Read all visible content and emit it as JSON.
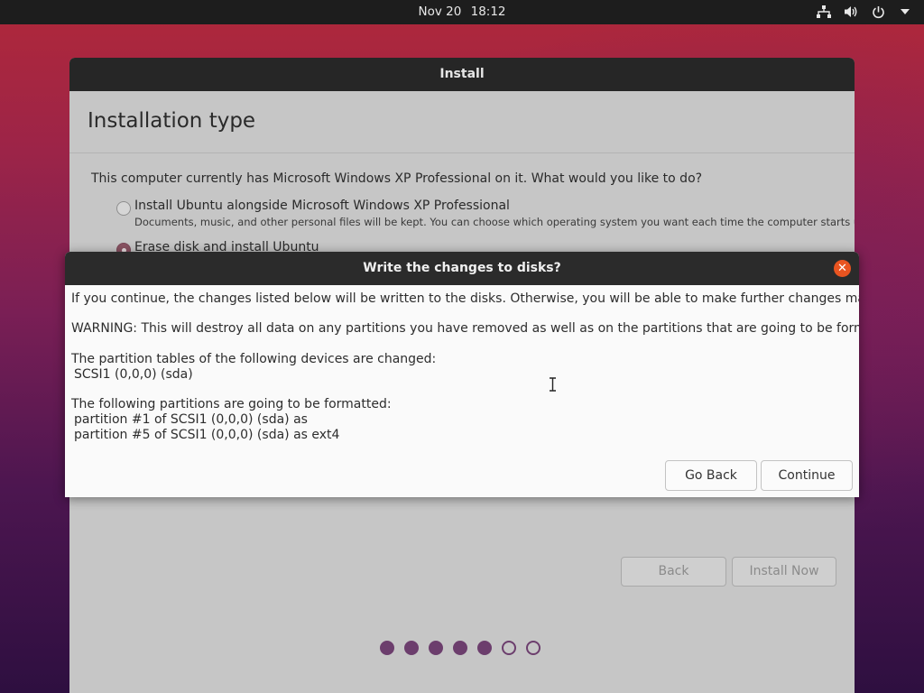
{
  "topbar": {
    "date": "Nov 20",
    "time": "18:12",
    "icons": [
      "network-icon",
      "volume-icon",
      "power-icon",
      "menu-arrow-icon"
    ]
  },
  "window": {
    "title": "Install",
    "heading": "Installation type",
    "question": "This computer currently has Microsoft Windows XP Professional on it. What would you like to do?",
    "options": [
      {
        "label": "Install Ubuntu alongside Microsoft Windows XP Professional",
        "description": "Documents, music, and other personal files will be kept. You can choose which operating system you want each time the computer starts up.",
        "selected": false
      },
      {
        "label": "Erase disk and install Ubuntu",
        "selected": true
      }
    ],
    "back_label": "Back",
    "install_label": "Install Now",
    "progress": {
      "total_steps": 7,
      "completed_steps": 5
    }
  },
  "dialog": {
    "title": "Write the changes to disks?",
    "line1": "If you continue, the changes listed below will be written to the disks. Otherwise, you will be able to make further changes manually.",
    "warning": "WARNING: This will destroy all data on any partitions you have removed as well as on the partitions that are going to be formatted.",
    "tables_header": "The partition tables of the following devices are changed:",
    "tables_device": "SCSI1 (0,0,0) (sda)",
    "format_header": "The following partitions are going to be formatted:",
    "format_item1": "partition #1 of SCSI1 (0,0,0) (sda) as",
    "format_item2": "partition #5 of SCSI1 (0,0,0) (sda) as ext4",
    "go_back_label": "Go Back",
    "continue_label": "Continue"
  },
  "colors": {
    "accent": "#e95420",
    "progress_dot": "#6c3e6d",
    "selected_radio": "#8a5363"
  }
}
